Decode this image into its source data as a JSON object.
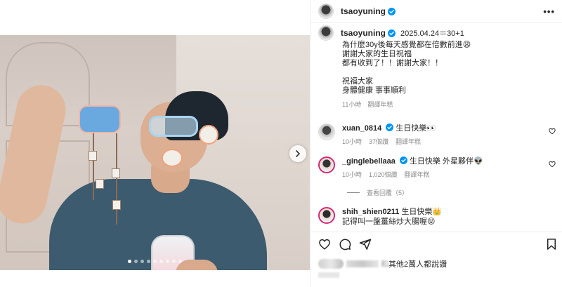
{
  "post": {
    "username": "tsaoyuning",
    "more_label": "•••",
    "carousel_count": 9,
    "carousel_active": 1
  },
  "caption": {
    "username": "tsaoyuning",
    "date": "2025.04.24＝30+1",
    "lines": "為什麼30y後每天感覺都在倍數前進😩\n謝謝大家的生日祝福\n都有收到了！！謝謝大家！！\n\n祝福大家\n身體健康 事事順利",
    "time": "11小時",
    "translate": "翻譯年糕"
  },
  "comments": [
    {
      "username": "xuan_0814",
      "text": "生日快樂👀",
      "time": "10小時",
      "likes": "37個讚",
      "translate": "翻譯年糕"
    },
    {
      "username": "_ginglebellaaa",
      "text": "生日快樂 外星夥伴👽",
      "time": "10小時",
      "likes": "1,020個讚",
      "translate": "翻譯年糕"
    },
    {
      "username": "shih_shien0211",
      "text": "生日快樂👑",
      "line2": "記得叫一盤薑絲炒大腸喔😝"
    }
  ],
  "view_replies": "查看回覆（5）",
  "likes_text": "其他2萬人都說讚",
  "likes_prefix": "和",
  "icons": {
    "heart": "heart-icon",
    "comment": "comment-icon",
    "share": "share-icon",
    "bookmark": "bookmark-icon",
    "verified": "verified-badge-icon",
    "next": "chevron-right-icon"
  },
  "colors": {
    "verified": "#0095f6",
    "secondary_text": "#8e8e8e",
    "border": "#efefef"
  }
}
